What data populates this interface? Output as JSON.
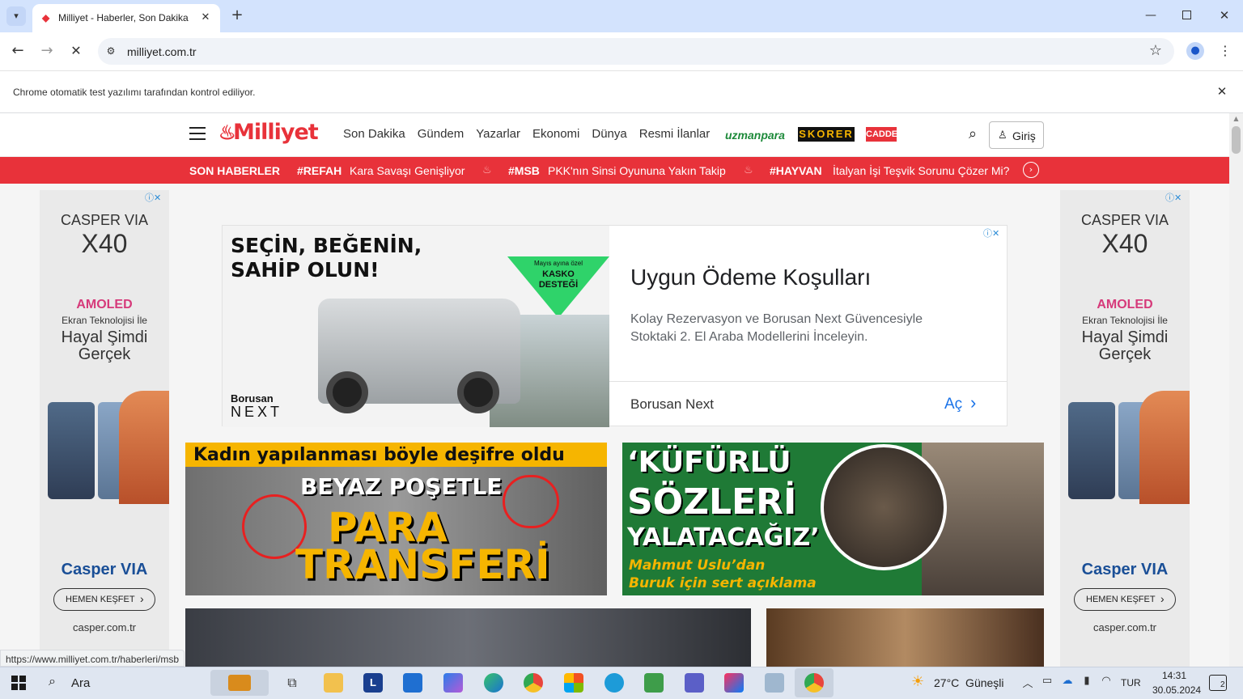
{
  "browser": {
    "tab_title": "Milliyet - Haberler, Son Dakika",
    "url": "milliyet.com.tr",
    "infobar_text": "Chrome otomatik test yazılımı tarafından kontrol ediliyor.",
    "status_url": "https://www.milliyet.com.tr/haberleri/msb"
  },
  "site": {
    "logo": "Milliyet",
    "nav": [
      "Son Dakika",
      "Gündem",
      "Yazarlar",
      "Ekonomi",
      "Dünya",
      "Resmi İlanlar"
    ],
    "partners": [
      "uzmanpara",
      "SKORER",
      "CADDE"
    ],
    "login": "Giriş"
  },
  "breaking": {
    "label": "SON HABERLER",
    "items": [
      {
        "tag": "#REFAH",
        "text": "Kara Savaşı Genişliyor"
      },
      {
        "tag": "#MSB",
        "text": "PKK'nın Sinsi Oyununa Yakın Takip"
      },
      {
        "tag": "#HAYVAN",
        "text": "İtalyan İşi Teşvik Sorunu Çözer Mi?"
      }
    ]
  },
  "side_ad": {
    "brand_top": "CASPER VIA",
    "model": "X40",
    "amoled": "AMOLED",
    "line1": "Ekran Teknolojisi İle",
    "line2": "Hayal Şimdi",
    "line3": "Gerçek",
    "brand_bottom": "Casper VIA",
    "cta": "HEMEN KEŞFET",
    "domain": "casper.com.tr"
  },
  "center_ad": {
    "slogan1": "SEÇİN, BEĞENİN,",
    "slogan2": "SAHİP OLUN!",
    "badge_small": "Mayıs ayına özel",
    "badge_line1": "KASKO",
    "badge_line2": "DESTEĞİ",
    "brand_line1": "Borusan",
    "brand_line2": "NEXT",
    "title": "Uygun Ödeme Koşulları",
    "desc": "Kolay Rezervasyon ve Borusan Next Güvencesiyle Stoktaki 2. El Araba Modellerini İnceleyin.",
    "advertiser": "Borusan Next",
    "open": "Aç"
  },
  "news": [
    {
      "top": "Kadın yapılanması böyle deşifre oldu",
      "mid": "BEYAZ POŞETLE",
      "big1": "PARA",
      "big2": "TRANSFERİ"
    },
    {
      "l1": "‘KÜFÜRLÜ",
      "l2": "SÖZLERİ",
      "l3": "YALATACAĞIZ’",
      "s1": "Mahmut Uslu’dan",
      "s2": "Buruk için sert açıklama"
    }
  ],
  "taskbar": {
    "search": "Ara",
    "weather": "27°C  Güneşli",
    "lang": "TUR",
    "time": "14:31",
    "date": "30.05.2024",
    "notif_count": "2"
  },
  "colors": {
    "brand_red": "#e8323a",
    "accent_yellow": "#f6b500",
    "green_bg": "#1f7a36"
  }
}
